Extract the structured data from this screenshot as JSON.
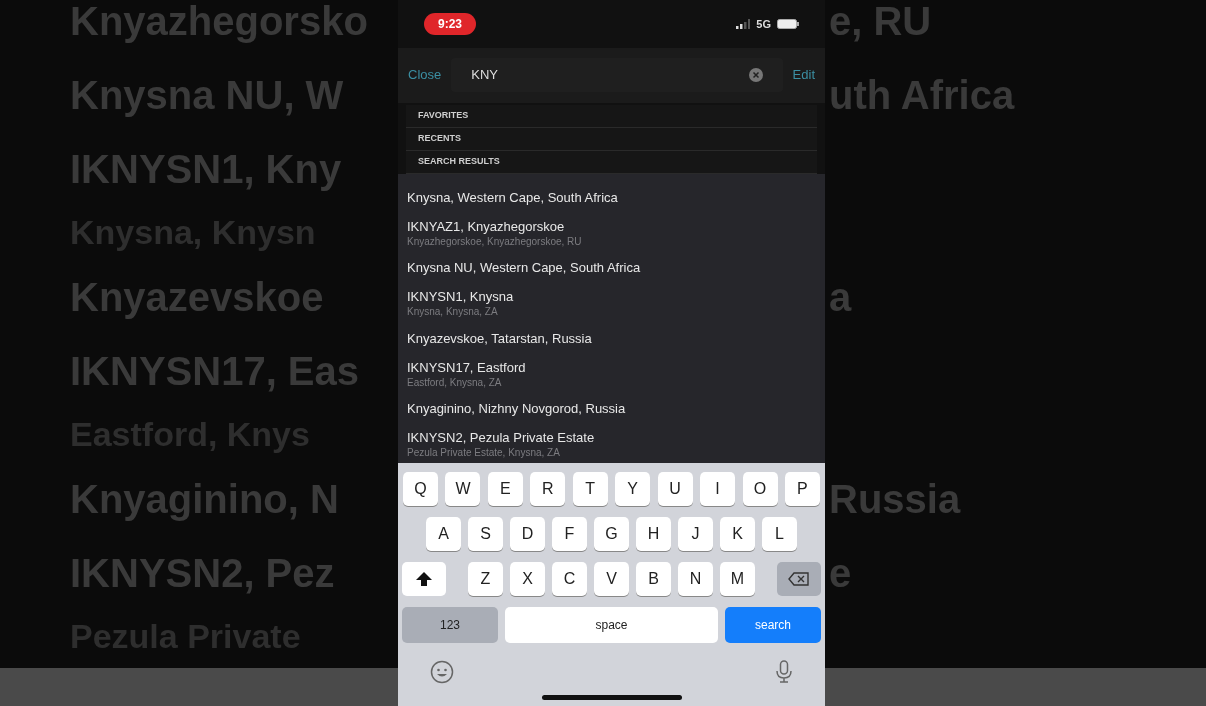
{
  "background": {
    "rows": [
      {
        "kind": "title",
        "left": "Knyazhegorsko",
        "right": "e, RU"
      },
      {
        "kind": "title",
        "left": "Knysna NU, W",
        "right": "uth Africa"
      },
      {
        "kind": "title",
        "left": "IKNYSN1, Kny"
      },
      {
        "kind": "subtitle",
        "left": "Knysna, Knysn"
      },
      {
        "kind": "title",
        "left": "Knyazevskoe",
        "right": "a"
      },
      {
        "kind": "title",
        "left": "IKNYSN17, Eas"
      },
      {
        "kind": "subtitle",
        "left": "Eastford, Knys"
      },
      {
        "kind": "title",
        "left": "Knyaginino, N",
        "right": "Russia"
      },
      {
        "kind": "title",
        "left": "IKNYSN2, Pez",
        "right": "e"
      },
      {
        "kind": "subtitle",
        "left": "Pezula Private"
      }
    ]
  },
  "status_bar": {
    "time": "9:23",
    "network": "5G"
  },
  "search_bar": {
    "cancel": "Close",
    "value": "KNY",
    "edit": "Edit"
  },
  "sections": [
    "FAVORITES",
    "RECENTS",
    "SEARCH RESULTS"
  ],
  "results": [
    {
      "title": "Knysna, Western Cape, South Africa"
    },
    {
      "title": "IKNYAZ1, Knyazhegorskoe",
      "subtitle": "Knyazhegorskoe, Knyazhegorskoe, RU"
    },
    {
      "title": "Knysna NU, Western Cape, South Africa"
    },
    {
      "title": "IKNYSN1, Knysna",
      "subtitle": "Knysna, Knysna, ZA"
    },
    {
      "title": "Knyazevskoe, Tatarstan, Russia"
    },
    {
      "title": "IKNYSN17, Eastford",
      "subtitle": "Eastford, Knysna, ZA"
    },
    {
      "title": "Knyaginino, Nizhny Novgorod, Russia"
    },
    {
      "title": "IKNYSN2, Pezula Private Estate",
      "subtitle": "Pezula Private Estate, Knysna, ZA"
    }
  ],
  "keyboard": {
    "rows": [
      [
        "Q",
        "W",
        "E",
        "R",
        "T",
        "Y",
        "U",
        "I",
        "O",
        "P"
      ],
      [
        "A",
        "S",
        "D",
        "F",
        "G",
        "H",
        "J",
        "K",
        "L"
      ],
      [
        "Z",
        "X",
        "C",
        "V",
        "B",
        "N",
        "M"
      ]
    ],
    "numbers": "123",
    "space": "space",
    "action": "search"
  }
}
